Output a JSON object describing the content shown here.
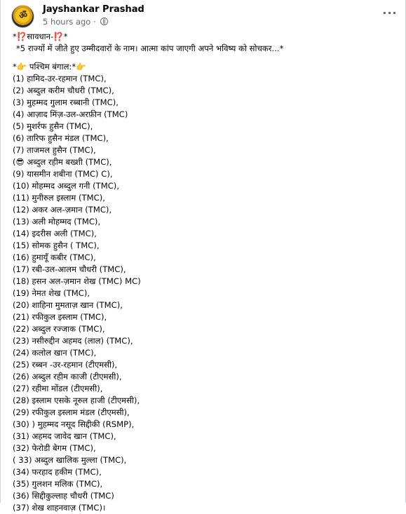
{
  "post": {
    "author": "Jayshankar Prashad",
    "time": "5 hours ago",
    "separator": "·",
    "more_label": "···",
    "avatar_glyph": "ॐ"
  },
  "body": {
    "warning_prefix": "*",
    "warning_mark": "⁉️",
    "warning_text": "सावधान-",
    "warning_suffix": "*",
    "subtitle": "*5 राज्यों में जीते हुए उम्मीदवारों के नाम। आत्मा कांप जाएगी अपने भविष्य को सोचकर...*",
    "region_prefix": "*",
    "region_hand_left": "👉",
    "region_label": "पश्चिम बंगाल:*",
    "region_hand_right": "👉",
    "lines": [
      "(1) हामिद-उर-रहमान (TMC),",
      "(2) अब्दुल करीम चौधरी (TMC),",
      "(3) मुहम्मद गुलाम रब्बानी (TMC),",
      "(4) आज़ाद मिंज़-उल-अरफ़ीन (TMC)",
      "(5) मुशर्रफ हुसैन (TMC),",
      "(6) तारिफ हुसैन मंडल (TMC),",
      "(7) ताजमल हुसैन (TMC),",
      "(😎 अब्दुल रहीम बख्शी (TMC),",
      "(9) यासमीन शबीना (TMC) C),",
      "(10) मोहम्मद अब्दुल गनी (TMC),",
      "(11) मुनीरुल इस्लाम (TMC),",
      "(12) अकर अल-ज़मान (TMC),",
      "(13) अली मोहम्मद (TMC),",
      "(14) इदरीस अली (TMC),",
      "(15) सोमक हुसैन ( TMC),",
      "(16) हुमायूँ कबीर (TMC),",
      "(17) रबी-उल-आलम चौधरी (TMC),",
      "(18) हसन अल-ज़मान शेख (TMC) MC)",
      "(19) नेमत शेख (TMC),",
      "(20) शाहिना मुमताज़ खान (TMC),",
      "(21) रफीकुल इस्लाम (TMC),",
      "(22) अब्दुल रज्जाक (TMC),",
      "(23) नसीरुद्दीन अहमद (लाल) (TMC),",
      "(24) कलोल खान (TMC),",
      "(25) रब्बन -उर-रहमान (टीएमसी),",
      "(26) अब्दुल रहीम काजी (टीएमसी),",
      "(27) रहीमा मोंडल (टीएमसी),",
      "(28) इस्लाम एसके नूरुल हाजी (टीएमसी),",
      "(29) रफीकुल इस्लाम मंडल (टीएमसी),",
      "(30) ) मुहम्मद नसूद सिद्दीकी (RSMP),",
      "(31) अहमद जावेद खान (TMC),",
      "(32) फेरोडी बेगम (TMC),",
      "( 33) अब्दुल खालिक मुल्ला (TMC),",
      "(34) फरहाद हकीम (TMC),",
      "(35) गुलशन मलिक (TMC),",
      "(36) सिद्दीकुल्लाह चौधरी (TMC)",
      "(37) शेख शाहनवाज़ (TMC)।"
    ]
  }
}
